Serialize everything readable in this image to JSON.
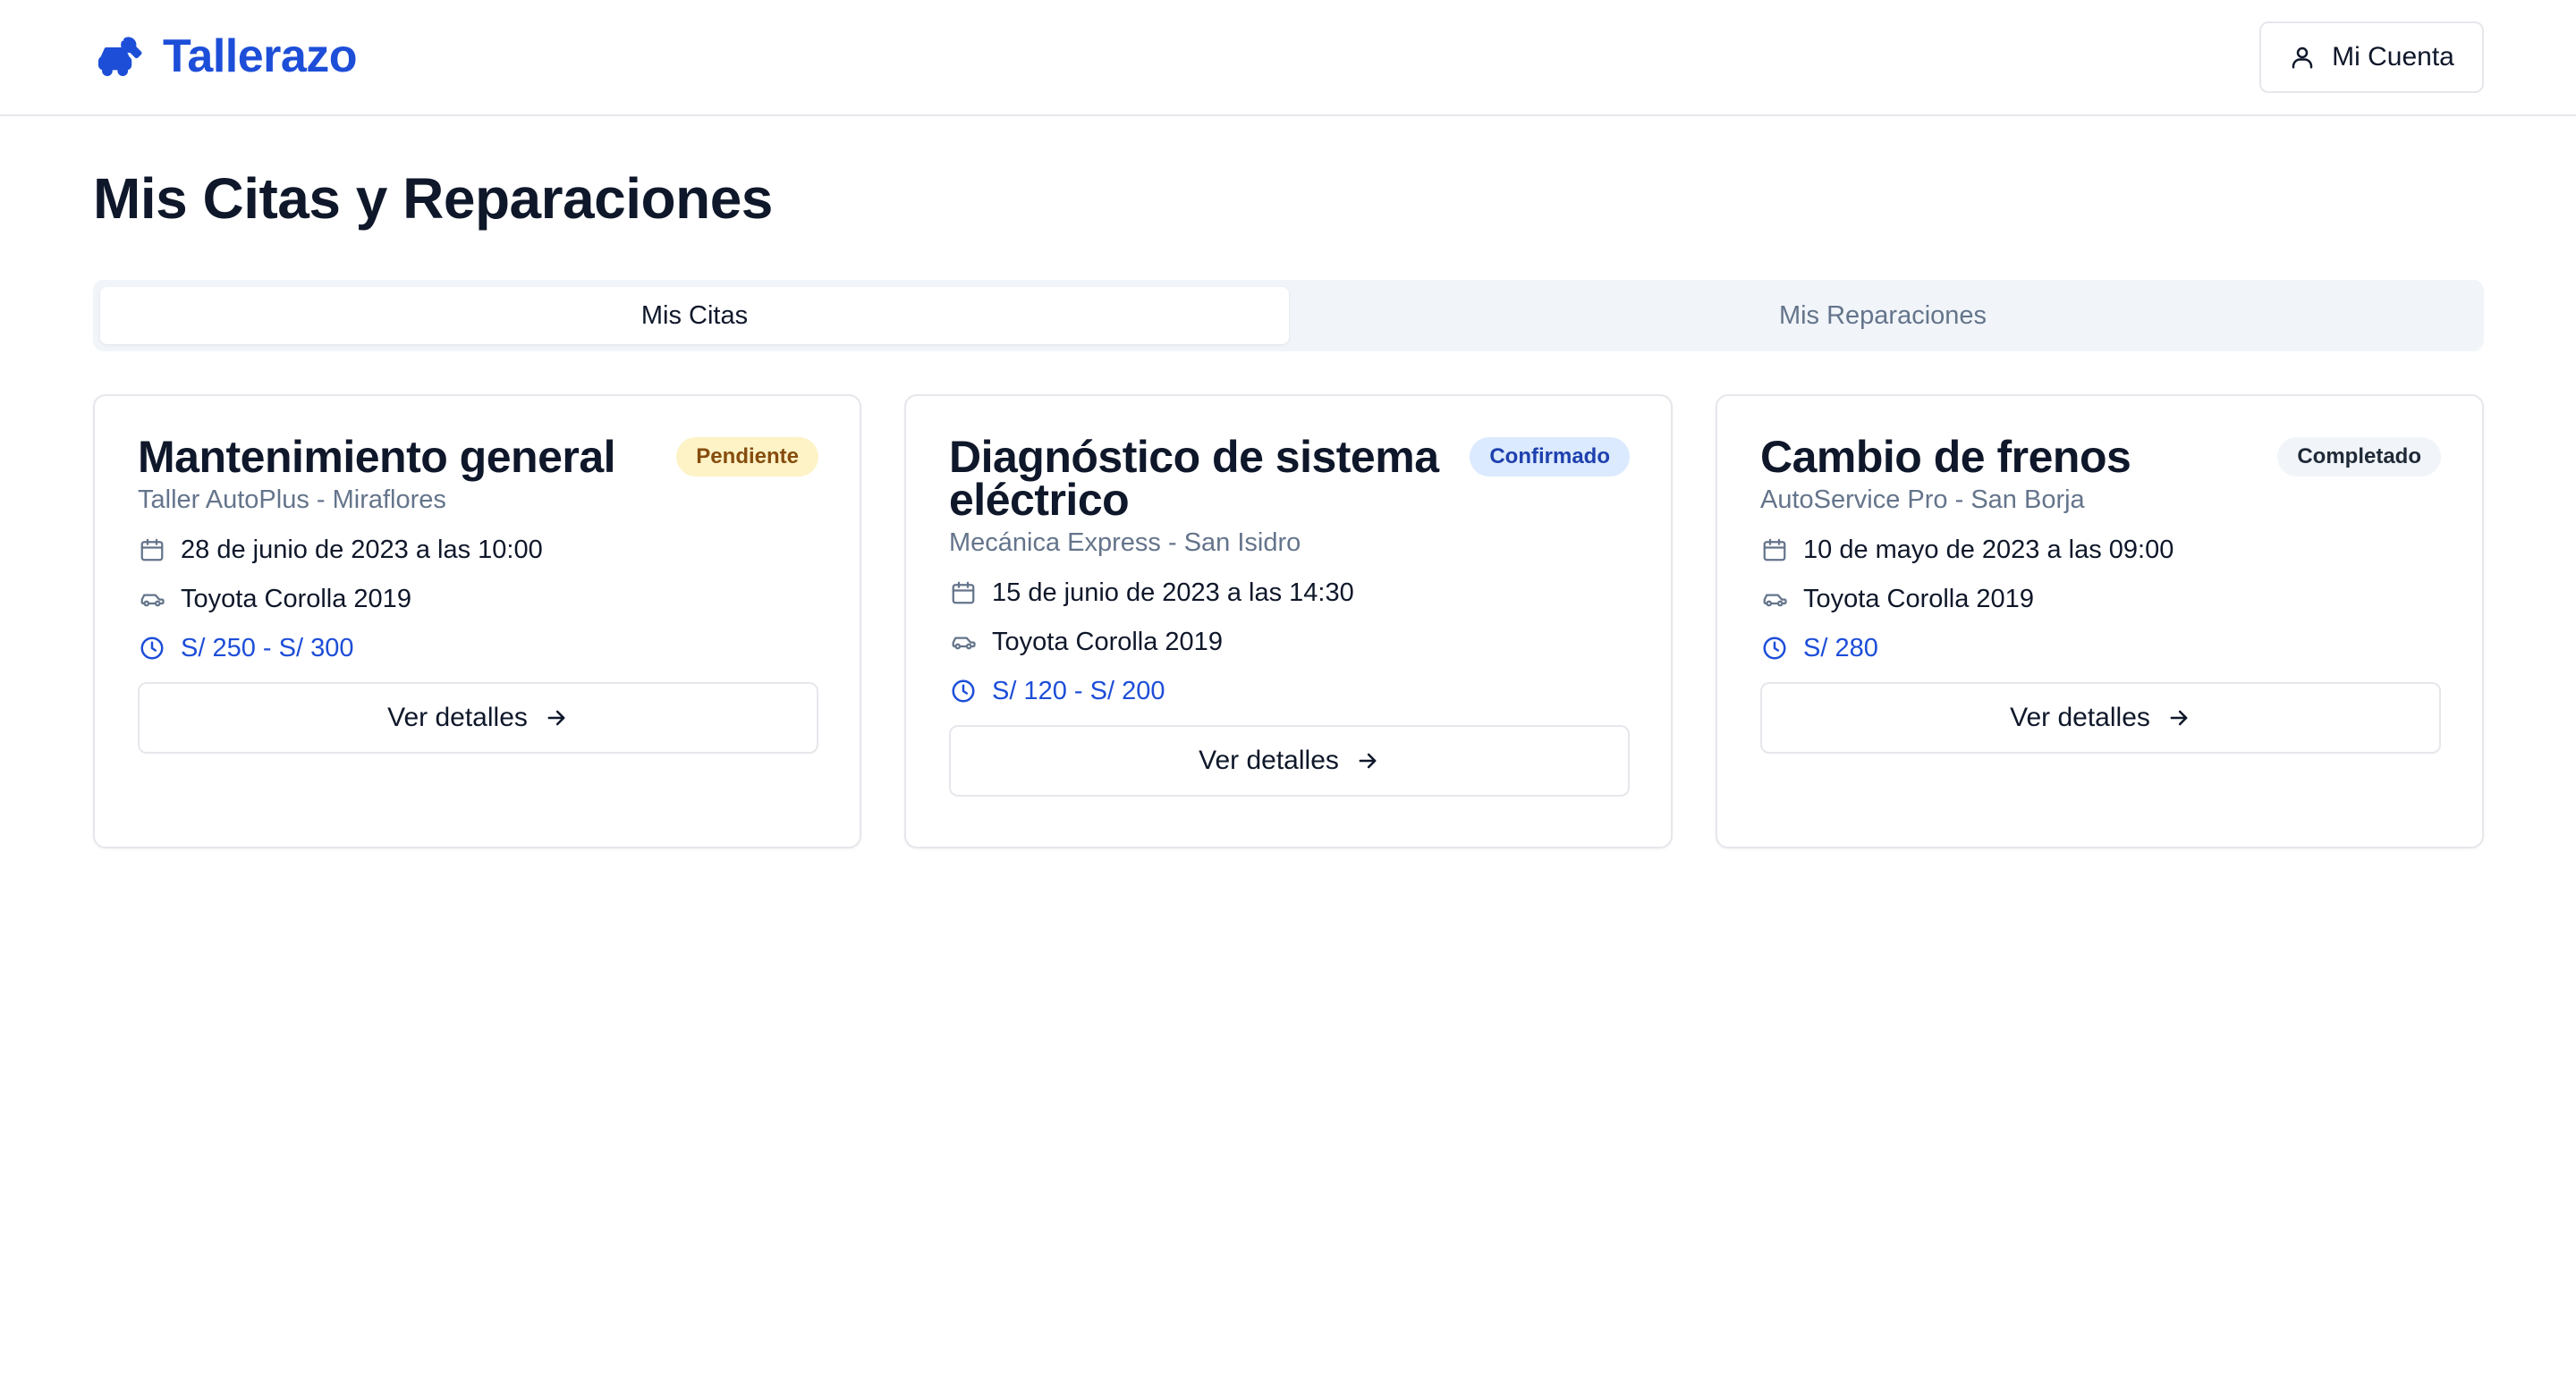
{
  "header": {
    "brand": "Tallerazo",
    "account_label": "Mi Cuenta"
  },
  "page": {
    "title": "Mis Citas y Reparaciones"
  },
  "tabs": [
    {
      "label": "Mis Citas",
      "active": true
    },
    {
      "label": "Mis Reparaciones",
      "active": false
    }
  ],
  "appointments": [
    {
      "title": "Mantenimiento general",
      "status": "Pendiente",
      "workshop": "Taller AutoPlus - Miraflores",
      "datetime": "28 de junio de 2023 a las 10:00",
      "vehicle": "Toyota Corolla 2019",
      "price": "S/ 250 - S/ 300",
      "button": "Ver detalles"
    },
    {
      "title": "Diagnóstico de sistema eléctrico",
      "status": "Confirmado",
      "workshop": "Mecánica Express - San Isidro",
      "datetime": "15 de junio de 2023 a las 14:30",
      "vehicle": "Toyota Corolla 2019",
      "price": "S/ 120 - S/ 200",
      "button": "Ver detalles"
    },
    {
      "title": "Cambio de frenos",
      "status": "Completado",
      "workshop": "AutoService Pro - San Borja",
      "datetime": "10 de mayo de 2023 a las 09:00",
      "vehicle": "Toyota Corolla 2019",
      "price": "S/ 280",
      "button": "Ver detalles"
    }
  ],
  "colors": {
    "brand": "#1d4ed8",
    "price": "#1d4ed8",
    "pending_bg": "#fef3c7",
    "confirmed_bg": "#dbeafe",
    "completed_bg": "#f1f5f9"
  },
  "icons": {
    "brand": "car-repair-icon",
    "account": "user-icon",
    "date": "calendar-icon",
    "vehicle": "car-icon",
    "price": "clock-icon",
    "details": "arrow-right-icon"
  }
}
